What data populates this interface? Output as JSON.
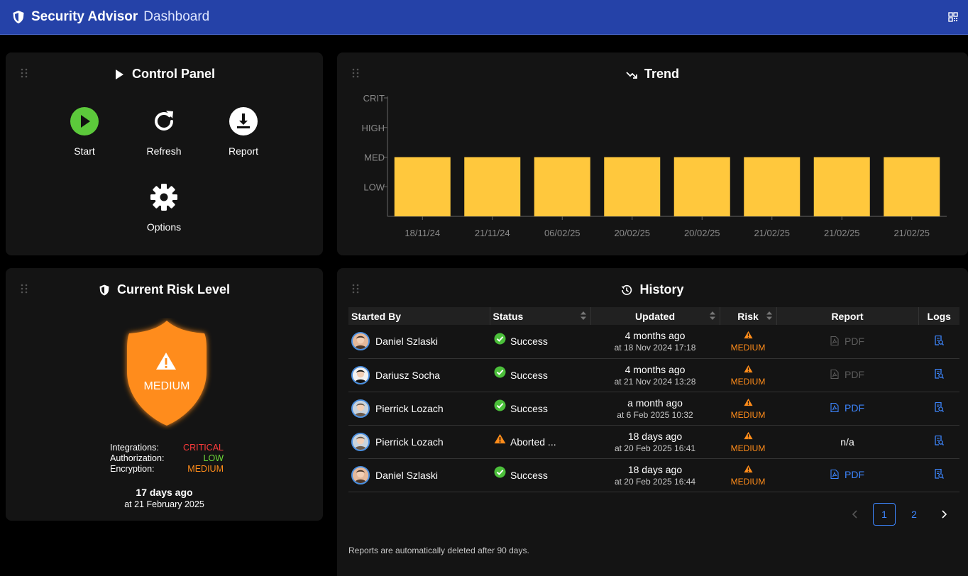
{
  "header": {
    "app_name": "Security Advisor",
    "page_name": "Dashboard",
    "brand_color": "#2542a8"
  },
  "control_panel": {
    "title": "Control Panel",
    "buttons": [
      {
        "label": "Start",
        "icon": "play-circle-icon"
      },
      {
        "label": "Refresh",
        "icon": "refresh-icon"
      },
      {
        "label": "Report",
        "icon": "download-icon"
      },
      {
        "label": "Options",
        "icon": "gear-icon"
      }
    ]
  },
  "trend": {
    "title": "Trend"
  },
  "chart_data": {
    "type": "bar",
    "categories": [
      "18/11/24",
      "21/11/24",
      "06/02/25",
      "20/02/25",
      "20/02/25",
      "21/02/25",
      "21/02/25",
      "21/02/25"
    ],
    "values": [
      2,
      2,
      2,
      2,
      2,
      2,
      2,
      2
    ],
    "y_tick_labels": [
      "LOW",
      "MED",
      "HIGH",
      "CRIT"
    ],
    "ylim": [
      0,
      4
    ],
    "bar_color": "#ffc83d",
    "grid": false
  },
  "risk": {
    "title": "Current Risk Level",
    "level": "MEDIUM",
    "shield_color": "#ff8c1a",
    "details": [
      {
        "label": "Integrations:",
        "value": "CRITICAL",
        "color": "#ff3b3b"
      },
      {
        "label": "Authorization:",
        "value": "LOW",
        "color": "#6fdc3a"
      },
      {
        "label": "Encryption:",
        "value": "MEDIUM",
        "color": "#ff8c1a"
      }
    ],
    "relative_time": "17 days ago",
    "absolute_time": "at 21 February 2025"
  },
  "history": {
    "title": "History",
    "columns": [
      "Started By",
      "Status",
      "Updated",
      "Risk",
      "Report",
      "Logs"
    ],
    "rows": [
      {
        "user": "Daniel Szlaski",
        "status": "Success",
        "status_kind": "ok",
        "updated": "4 months ago",
        "updated_at": "at 18 Nov 2024 17:18",
        "risk": "MEDIUM",
        "report": "PDF",
        "report_state": "off"
      },
      {
        "user": "Dariusz Socha",
        "status": "Success",
        "status_kind": "ok",
        "updated": "4 months ago",
        "updated_at": "at 21 Nov 2024 13:28",
        "risk": "MEDIUM",
        "report": "PDF",
        "report_state": "off"
      },
      {
        "user": "Pierrick Lozach",
        "status": "Success",
        "status_kind": "ok",
        "updated": "a month ago",
        "updated_at": "at 6 Feb 2025 10:32",
        "risk": "MEDIUM",
        "report": "PDF",
        "report_state": "on"
      },
      {
        "user": "Pierrick Lozach",
        "status": "Aborted ...",
        "status_kind": "warn",
        "updated": "18 days ago",
        "updated_at": "at 20 Feb 2025 16:41",
        "risk": "MEDIUM",
        "report": "n/a",
        "report_state": "na"
      },
      {
        "user": "Daniel Szlaski",
        "status": "Success",
        "status_kind": "ok",
        "updated": "18 days ago",
        "updated_at": "at 20 Feb 2025 16:44",
        "risk": "MEDIUM",
        "report": "PDF",
        "report_state": "on"
      }
    ],
    "pages": [
      "1",
      "2"
    ],
    "current_page": "1",
    "footnote": "Reports are automatically deleted after 90 days."
  }
}
